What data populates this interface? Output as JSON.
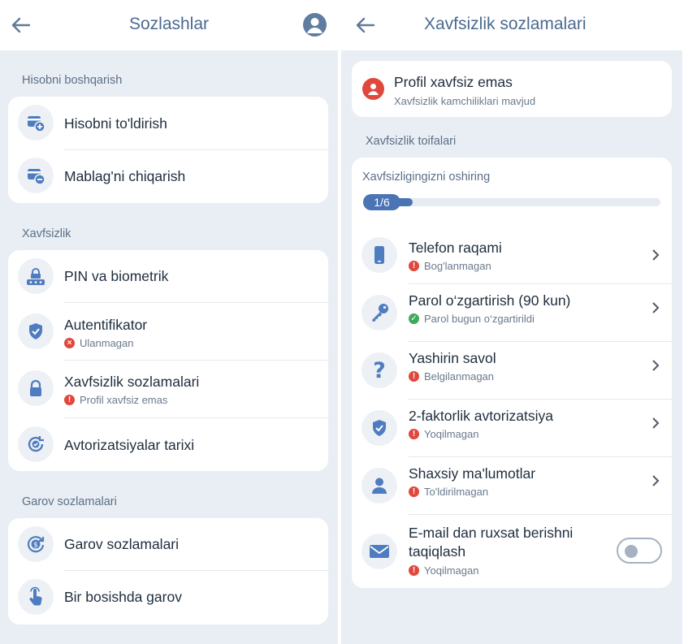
{
  "colors": {
    "accent": "#4a74b4",
    "icon": "#4f7cc0",
    "error": "#e0473d",
    "success": "#3faa5a",
    "bg": "#e9eef4"
  },
  "left": {
    "header": {
      "title": "Sozlashlar",
      "back_icon": "arrow-left-icon",
      "profile_icon": "user-circle-icon"
    },
    "sections": [
      {
        "label": "Hisobni boshqarish",
        "items": [
          {
            "label": "Hisobni to'ldirish",
            "icon": "wallet-plus-icon"
          },
          {
            "label": "Mablag'ni chiqarish",
            "icon": "wallet-minus-icon"
          }
        ]
      },
      {
        "label": "Xavfsizlik",
        "items": [
          {
            "label": "PIN va biometrik",
            "icon": "pin-keypad-icon"
          },
          {
            "label": "Autentifikator",
            "icon": "shield-check-icon",
            "status": "Ulanmagan",
            "status_type": "error-x"
          },
          {
            "label": "Xavfsizlik sozlamalari",
            "icon": "lock-icon",
            "status": "Profil xavfsiz emas",
            "status_type": "error"
          },
          {
            "label": "Avtorizatsiyalar tarixi",
            "icon": "history-check-icon"
          }
        ]
      },
      {
        "label": "Garov sozlamalari",
        "items": [
          {
            "label": "Garov sozlamalari",
            "icon": "coin-cycle-icon"
          },
          {
            "label": "Bir bosishda garov",
            "icon": "tap-hand-icon"
          }
        ]
      }
    ]
  },
  "right": {
    "header": {
      "title": "Xavfsizlik sozlamalari",
      "back_icon": "arrow-left-icon"
    },
    "alert": {
      "title": "Profil xavfsiz emas",
      "subtitle": "Xavfsizlik kamchiliklari mavjud",
      "icon": "alert-circle-icon"
    },
    "section_label": "Xavfsizlik toifalari",
    "progress": {
      "label": "Xavfsizligingizni oshiring",
      "text": "1/6",
      "fraction": 0.1667
    },
    "items": [
      {
        "label": "Telefon raqami",
        "icon": "phone-icon",
        "status": "Bog'lanmagan",
        "status_type": "error"
      },
      {
        "label": "Parol o‘zgartirish (90 kun)",
        "icon": "key-icon",
        "status": "Parol bugun o‘zgartirildi",
        "status_type": "success"
      },
      {
        "label": "Yashirin savol",
        "icon": "question-icon",
        "status": "Belgilanmagan",
        "status_type": "error"
      },
      {
        "label": "2-faktorlik avtorizatsiya",
        "icon": "shield-check-icon",
        "status": "Yoqilmagan",
        "status_type": "error"
      },
      {
        "label": "Shaxsiy ma'lumotlar",
        "icon": "user-icon",
        "status": "To'ldirilmagan",
        "status_type": "error"
      }
    ],
    "email": {
      "label_line1": "E-mail dan ruxsat berishni",
      "label_line2": "taqiqlash",
      "icon": "mail-icon",
      "status": "Yoqilmagan",
      "status_type": "error",
      "toggle_on": false
    }
  }
}
